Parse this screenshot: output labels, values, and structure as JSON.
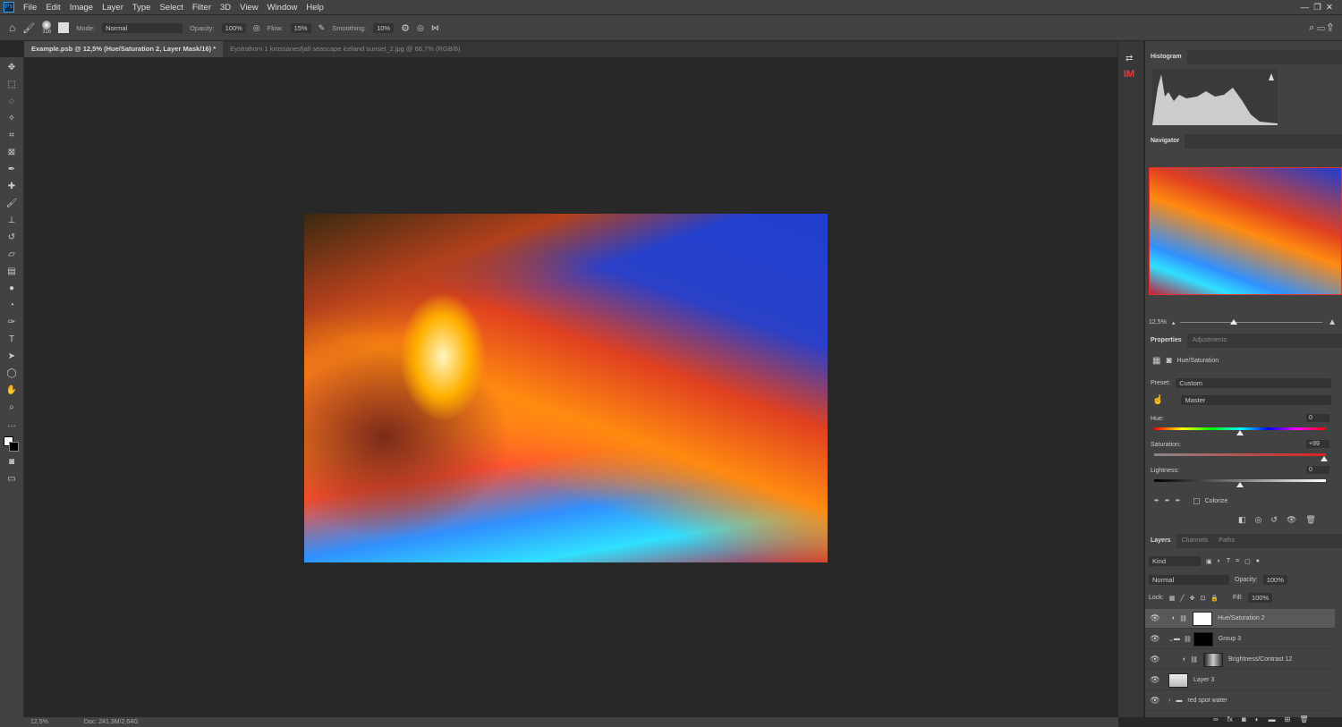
{
  "menu": [
    "File",
    "Edit",
    "Image",
    "Layer",
    "Type",
    "Select",
    "Filter",
    "3D",
    "View",
    "Window",
    "Help"
  ],
  "options": {
    "brush_size": "316",
    "mode_label": "Mode:",
    "mode": "Normal",
    "opacity_label": "Opacity:",
    "opacity": "100%",
    "flow_label": "Flow:",
    "flow": "15%",
    "smoothing_label": "Smoothing:",
    "smoothing": "10%"
  },
  "tabs": [
    {
      "label": "Example.psb @ 12,5% (Hue/Saturation 2, Layer Mask/16) *",
      "active": true
    },
    {
      "label": "Eystrahorn 1 krossanesfjall seascape iceland sunset_2.jpg @ 66,7% (RGB/8)",
      "active": false
    }
  ],
  "right_strip": {
    "im_label": "IM"
  },
  "histogram": {
    "title": "Histogram"
  },
  "navigator": {
    "title": "Navigator",
    "zoom": "12,5%"
  },
  "properties": {
    "tabs": [
      "Properties",
      "Adjustments"
    ],
    "type": "Hue/Saturation",
    "preset_label": "Preset:",
    "preset": "Custom",
    "channel": "Master",
    "hue_label": "Hue:",
    "hue": "0",
    "hue_pct": 50,
    "saturation_label": "Saturation:",
    "saturation": "+99",
    "saturation_pct": 99,
    "lightness_label": "Lightness:",
    "lightness": "0",
    "lightness_pct": 50,
    "colorize": "Colorize"
  },
  "layers": {
    "tabs": [
      "Layers",
      "Channels",
      "Paths"
    ],
    "filter": "Kind",
    "blend": "Normal",
    "opacity_label": "Opacity:",
    "opacity": "100%",
    "lock_label": "Lock:",
    "fill_label": "Fill:",
    "fill": "100%",
    "items": [
      {
        "name": "Hue/Saturation 2",
        "selected": true
      },
      {
        "name": "Group 3"
      },
      {
        "name": "Brightness/Contrast 12"
      },
      {
        "name": "Layer 3"
      },
      {
        "name": "red spot water"
      }
    ]
  },
  "status": {
    "zoom": "12,5%",
    "doc": "Doc: 241,3M/2,64G"
  }
}
